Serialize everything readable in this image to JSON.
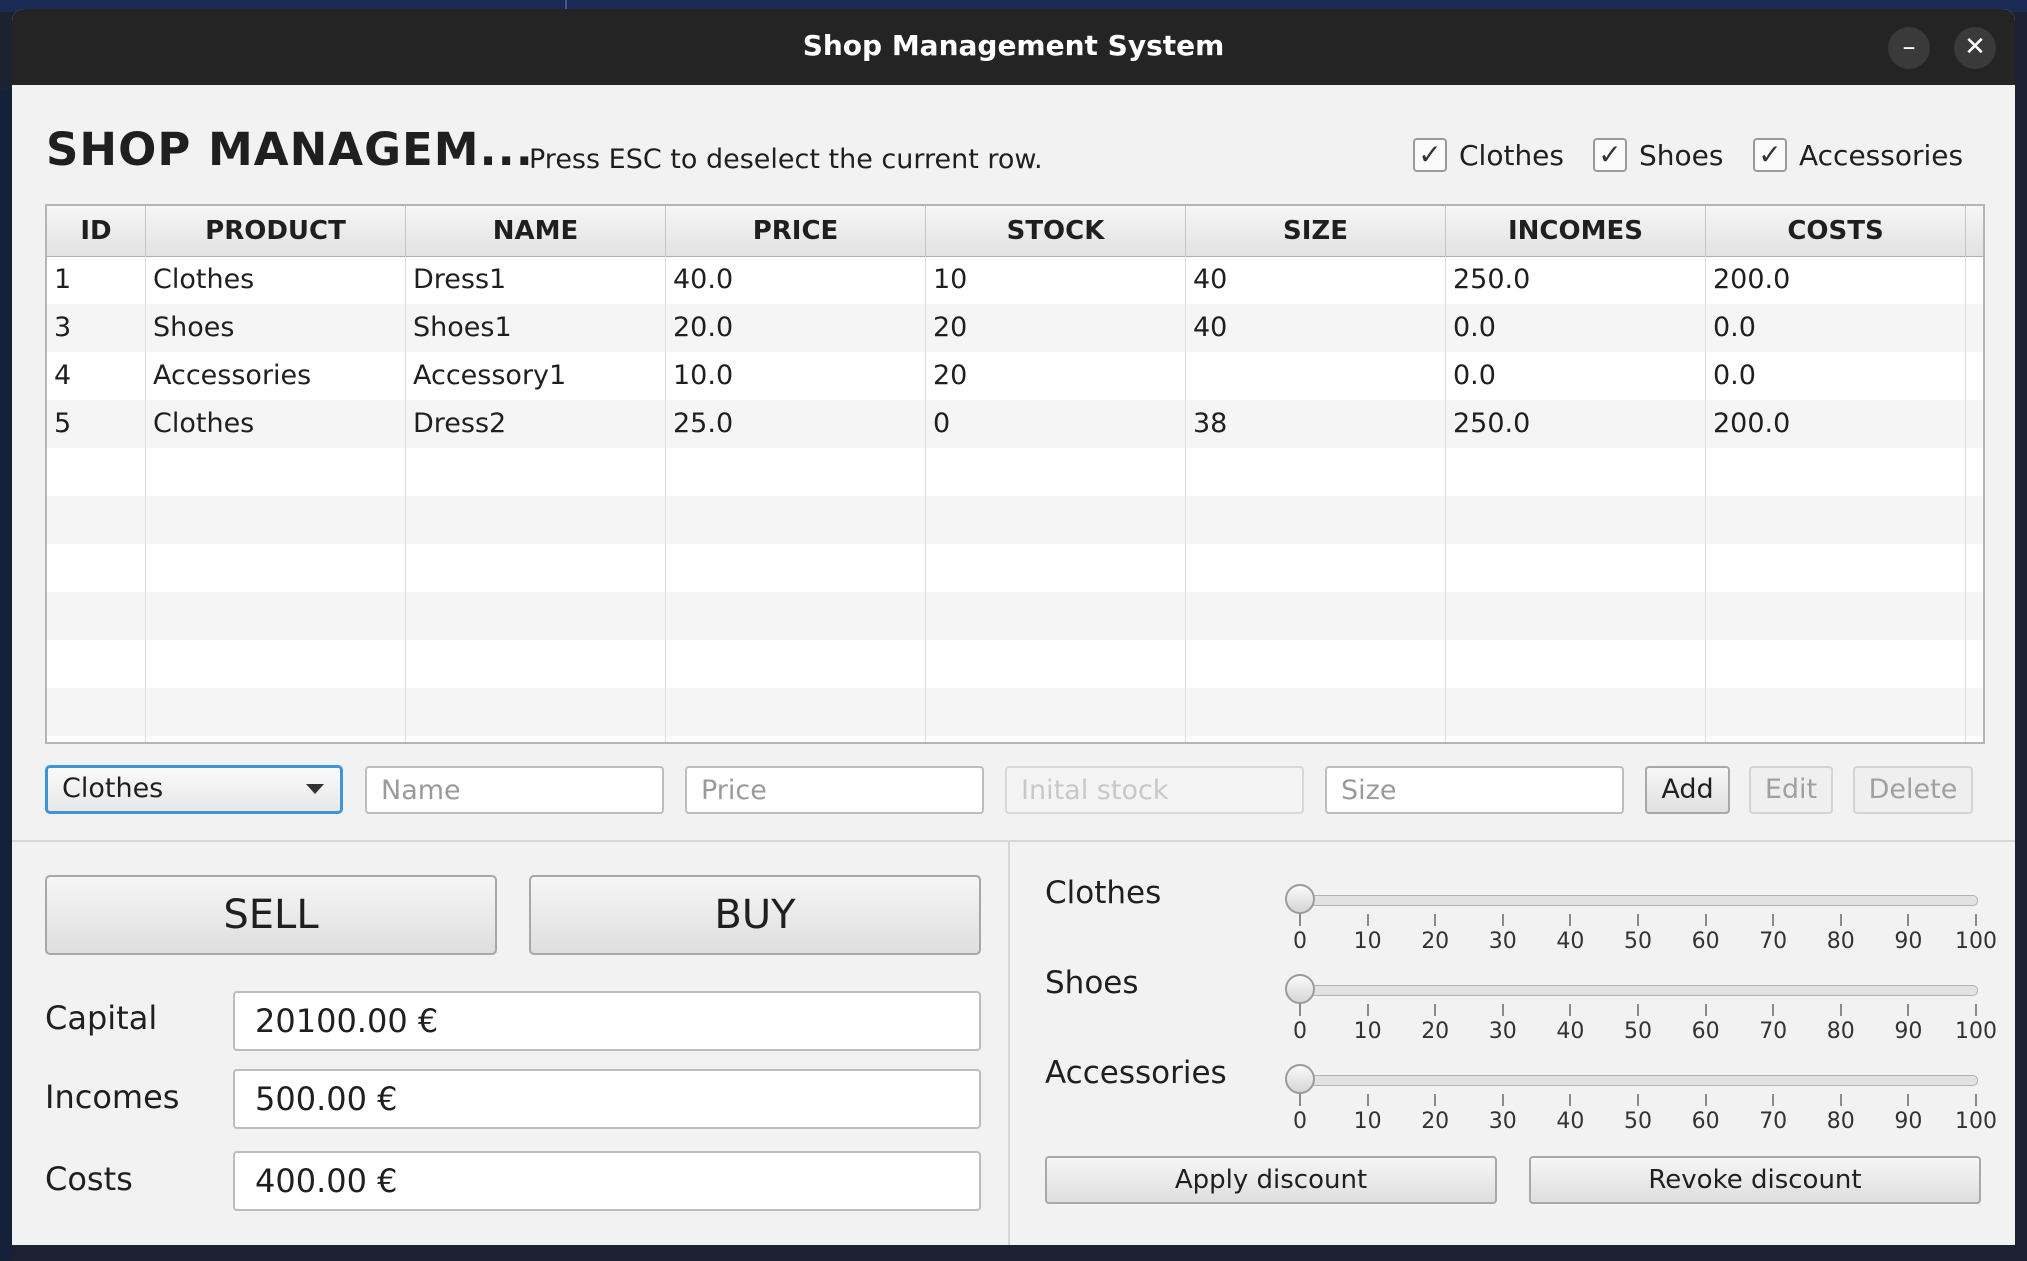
{
  "window": {
    "title": "Shop Management System",
    "minimize_glyph": "–",
    "close_glyph": "✕"
  },
  "header": {
    "heading": "SHOP MANAGEM...",
    "hint": "Press ESC to deselect the current row."
  },
  "filters": [
    {
      "label": "Clothes",
      "checked": true
    },
    {
      "label": "Shoes",
      "checked": true
    },
    {
      "label": "Accessories",
      "checked": true
    }
  ],
  "table": {
    "columns": [
      "ID",
      "PRODUCT",
      "NAME",
      "PRICE",
      "STOCK",
      "SIZE",
      "INCOMES",
      "COSTS"
    ],
    "rows": [
      [
        "1",
        "Clothes",
        "Dress1",
        "40.0",
        "10",
        "40",
        "250.0",
        "200.0"
      ],
      [
        "3",
        "Shoes",
        "Shoes1",
        "20.0",
        "20",
        "40",
        "0.0",
        "0.0"
      ],
      [
        "4",
        "Accessories",
        "Accessory1",
        "10.0",
        "20",
        "",
        "0.0",
        "0.0"
      ],
      [
        "5",
        "Clothes",
        "Dress2",
        "25.0",
        "0",
        "38",
        "250.0",
        "200.0"
      ]
    ]
  },
  "form": {
    "category_selected": "Clothes",
    "name_placeholder": "Name",
    "price_placeholder": "Price",
    "stock_placeholder": "Inital stock",
    "size_placeholder": "Size",
    "add_label": "Add",
    "edit_label": "Edit",
    "delete_label": "Delete"
  },
  "actions": {
    "sell_label": "SELL",
    "buy_label": "BUY"
  },
  "finance": {
    "capital_label": "Capital",
    "capital_value": "20100.00 €",
    "incomes_label": "Incomes",
    "incomes_value": "500.00 €",
    "costs_label": "Costs",
    "costs_value": "400.00 €"
  },
  "discounts": {
    "sliders": [
      {
        "label": "Clothes",
        "value": 0
      },
      {
        "label": "Shoes",
        "value": 0
      },
      {
        "label": "Accessories",
        "value": 0
      }
    ],
    "tick_labels": [
      "0",
      "10",
      "20",
      "30",
      "40",
      "50",
      "60",
      "70",
      "80",
      "90",
      "100"
    ],
    "apply_label": "Apply discount",
    "revoke_label": "Revoke discount"
  },
  "icons": {
    "check": "check-icon",
    "dropdown": "chevron-down-icon",
    "minimize": "minimize-icon",
    "close": "close-icon"
  }
}
